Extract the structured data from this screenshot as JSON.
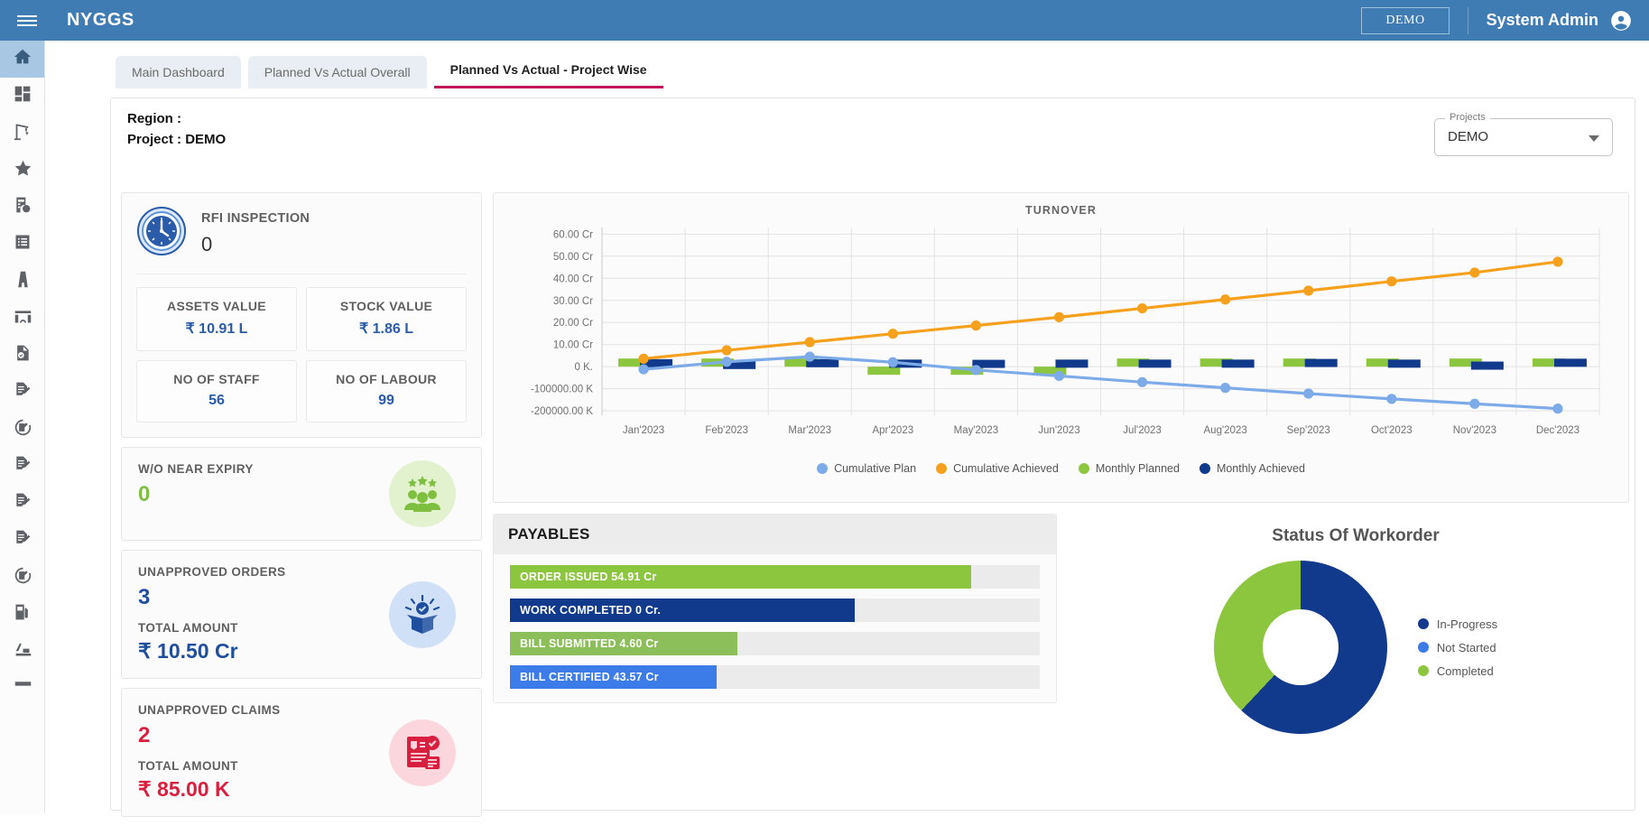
{
  "topbar": {
    "menu_icon": "hamburger-icon",
    "brand": "NYGGS",
    "demo_chip": "DEMO",
    "user_name": "System Admin",
    "avatar_icon": "account-circle-icon"
  },
  "sidebar": {
    "items": [
      {
        "icon": "home-icon",
        "active": true
      },
      {
        "icon": "dashboard-grid-icon",
        "active": false
      },
      {
        "icon": "crane-icon",
        "active": false
      },
      {
        "icon": "star-icon",
        "active": false
      },
      {
        "icon": "billing-rupee-icon",
        "active": false
      },
      {
        "icon": "list-icon",
        "active": false
      },
      {
        "icon": "highway-icon",
        "active": false
      },
      {
        "icon": "bridge-icon",
        "active": false
      },
      {
        "icon": "document-check-icon",
        "active": false
      },
      {
        "icon": "document-edit-icon",
        "active": false
      },
      {
        "icon": "document-edit-history-icon",
        "active": false
      },
      {
        "icon": "document-edit-icon",
        "active": false
      },
      {
        "icon": "document-edit-icon",
        "active": false
      },
      {
        "icon": "document-edit-icon",
        "active": false
      },
      {
        "icon": "document-edit-history-icon",
        "active": false
      },
      {
        "icon": "fuel-pump-icon",
        "active": false
      },
      {
        "icon": "excavator-icon",
        "active": false
      },
      {
        "icon": "road-roller-icon",
        "active": false
      }
    ]
  },
  "tabs": [
    {
      "label": "Main Dashboard",
      "active": false
    },
    {
      "label": "Planned Vs Actual Overall",
      "active": false
    },
    {
      "label": "Planned Vs Actual - Project Wise",
      "active": true
    }
  ],
  "filters": {
    "region_label": "Region :",
    "region_value": "",
    "project_label": "Project :",
    "project_value": "DEMO",
    "projects_legend": "Projects",
    "projects_value": "DEMO",
    "caret_icon": "chevron-down-icon"
  },
  "rfi_card": {
    "icon": "clock-icon",
    "title": "RFI INSPECTION",
    "value": "0",
    "metrics": [
      {
        "label": "ASSETS VALUE",
        "value": "₹ 10.91 L"
      },
      {
        "label": "STOCK VALUE",
        "value": "₹ 1.86 L"
      },
      {
        "label": "NO OF STAFF",
        "value": "56"
      },
      {
        "label": "NO OF LABOUR",
        "value": "99"
      }
    ]
  },
  "stat_cards": [
    {
      "name": "wo-near-expiry",
      "label": "W/O NEAR EXPIRY",
      "big": "0",
      "big_color": "#7fbf3f",
      "sub_label": "",
      "amount": "",
      "icon": "team-stars-icon",
      "icon_bg": "#e2f2cf",
      "icon_color": "#7fbf3f"
    },
    {
      "name": "unapproved-orders",
      "label": "UNAPPROVED ORDERS",
      "big": "3",
      "big_color": "#1f4e9c",
      "sub_label": "TOTAL AMOUNT",
      "amount": "₹ 10.50 Cr",
      "icon": "open-box-check-icon",
      "icon_bg": "#cfe0f7",
      "icon_color": "#1f4e9c"
    },
    {
      "name": "unapproved-claims",
      "label": "UNAPPROVED CLAIMS",
      "big": "2",
      "big_color": "#d81f3f",
      "sub_label": "TOTAL AMOUNT",
      "amount": "₹ 85.00 K",
      "icon": "claim-document-icon",
      "icon_bg": "#fbd7dd",
      "icon_color": "#d81f3f"
    }
  ],
  "payables": {
    "title": "PAYABLES",
    "rows": [
      {
        "label": "ORDER ISSUED 54.91 Cr",
        "pct": 87,
        "color": "#8cc63f"
      },
      {
        "label": "WORK COMPLETED 0 Cr.",
        "pct": 65,
        "color": "#11398c"
      },
      {
        "label": "BILL SUBMITTED 4.60 Cr",
        "pct": 43,
        "color": "#8cbf5a"
      },
      {
        "label": "BILL CERTIFIED 43.57 Cr",
        "pct": 39,
        "color": "#3b7ce8"
      }
    ]
  },
  "workorder": {
    "title": "Status Of Workorder"
  },
  "chart_data": [
    {
      "type": "line",
      "name": "turnover",
      "title": "TURNOVER",
      "xlabel": "",
      "ylabel": "",
      "grid": true,
      "legend_position": "bottom",
      "categories": [
        "Jan'2023",
        "Feb'2023",
        "Mar'2023",
        "Apr'2023",
        "May'2023",
        "Jun'2023",
        "Jul'2023",
        "Aug'2023",
        "Sep'2023",
        "Oct'2023",
        "Nov'2023",
        "Dec'2023"
      ],
      "ytick_labels": [
        "60.00 Cr",
        "50.00 Cr",
        "40.00 Cr",
        "30.00 Cr",
        "20.00 Cr",
        "10.00 Cr",
        "0 K.",
        "-100000.00 K",
        "-200000.00 K"
      ],
      "ytick_values": [
        60,
        50,
        40,
        30,
        20,
        10,
        0,
        -10,
        -20
      ],
      "ylim": [
        -22,
        63
      ],
      "series": [
        {
          "name": "Cumulative Plan",
          "type": "line",
          "color": "#7cabe8",
          "values": [
            -1.2,
            2.2,
            4.5,
            2.0,
            -1.5,
            -4.2,
            -7.0,
            -9.6,
            -12.2,
            -14.6,
            -16.8,
            -19.0
          ]
        },
        {
          "name": "Cumulative Achieved",
          "type": "line",
          "color": "#f5a11d",
          "values": [
            3.6,
            7.4,
            11.1,
            14.9,
            18.6,
            22.4,
            26.4,
            30.4,
            34.4,
            38.6,
            42.6,
            47.5
          ]
        },
        {
          "name": "Monthly Planned",
          "type": "bar",
          "color": "#8cc63f",
          "values": [
            0.2,
            1.6,
            1.2,
            -1.3,
            -0.9,
            -1.5,
            1.0,
            1.1,
            1.1,
            1.0,
            1.0,
            1.1
          ]
        },
        {
          "name": "Monthly Achieved",
          "type": "bar",
          "color": "#11398c",
          "values": [
            3.4,
            2.6,
            3.4,
            3.2,
            3.1,
            3.2,
            3.2,
            3.2,
            3.5,
            3.2,
            2.3,
            3.6
          ]
        }
      ]
    },
    {
      "type": "pie",
      "name": "status-of-workorder",
      "title": "Status Of Workorder",
      "donut": true,
      "legend_position": "right",
      "labels": [
        "In-Progress",
        "Not Started",
        "Completed"
      ],
      "values": [
        62,
        0,
        38
      ],
      "colors": [
        "#11398c",
        "#3b7ce8",
        "#8cc63f"
      ]
    }
  ]
}
